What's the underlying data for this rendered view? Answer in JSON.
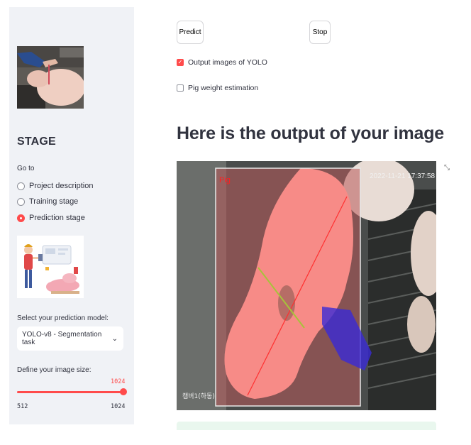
{
  "sidebar": {
    "title": "STAGE",
    "goto_label": "Go to",
    "nav_options": [
      {
        "label": "Project description",
        "selected": false
      },
      {
        "label": "Training stage",
        "selected": false
      },
      {
        "label": "Prediction stage",
        "selected": true
      }
    ],
    "model_label": "Select your prediction model:",
    "model_value": "YOLO-v8 - Segmentation task",
    "size_label": "Define your image size:",
    "size_value": "1024",
    "size_min": "512",
    "size_max": "1024"
  },
  "main": {
    "predict_label": "Predict",
    "stop_label": "Stop",
    "checkboxes": [
      {
        "label": "Output images of YOLO",
        "checked": true
      },
      {
        "label": "Pig weight estimation",
        "checked": false
      }
    ],
    "heading": "Here is the output of your image",
    "image": {
      "class_label": "Pig",
      "timestamp": "2022-11-21 17:37:58",
      "camera_label": "캠버1(하동)"
    }
  },
  "colors": {
    "accent": "#ff4b4b",
    "sidebar_bg": "#f0f2f6",
    "success_bg": "#e9f7ee",
    "mask": "#ff5252",
    "secondary_mask": "#3a2bd6"
  }
}
